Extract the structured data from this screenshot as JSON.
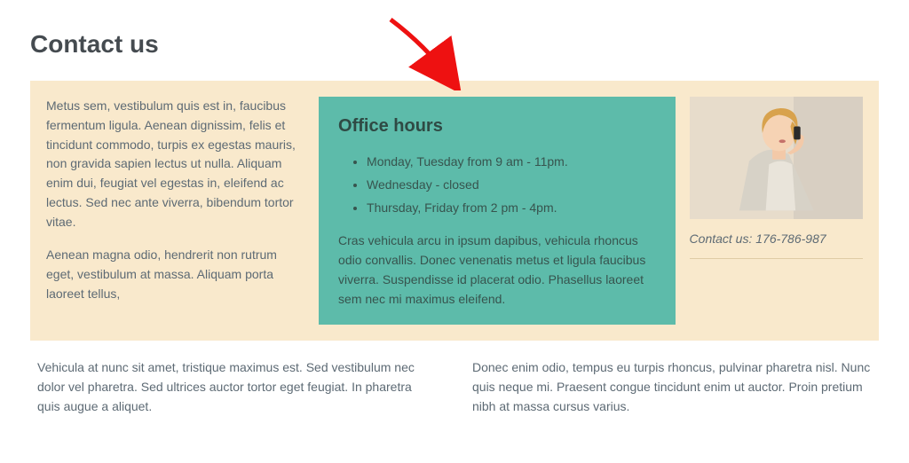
{
  "title": "Contact us",
  "left": {
    "p1": "Metus sem, vestibulum quis est in, faucibus fermentum ligula. Aenean dignissim, felis et tincidunt commodo, turpis ex egestas mauris, non gravida sapien lectus ut nulla. Aliquam enim dui, feugiat vel egestas in, eleifend ac lectus. Sed nec ante viverra, bibendum tortor vitae.",
    "p2": "Aenean magna odio, hendrerit non rutrum eget, vestibulum at massa. Aliquam porta laoreet tellus,"
  },
  "mid": {
    "heading": "Office hours",
    "items": [
      "Monday, Tuesday from 9 am - 11pm.",
      "Wednesday - closed",
      "Thursday, Friday from 2 pm - 4pm."
    ],
    "p": "Cras vehicula arcu in ipsum dapibus, vehicula rhoncus odio convallis. Donec venenatis metus et ligula faucibus viverra. Suspendisse id placerat odio. Phasellus laoreet sem nec mi maximus eleifend."
  },
  "right": {
    "contact": "Contact us: 176-786-987"
  },
  "bottom": {
    "p1": "Vehicula at nunc sit amet, tristique maximus est. Sed vestibulum nec dolor vel pharetra. Sed ultrices auctor tortor eget feugiat. In pharetra quis augue a aliquet.",
    "p2": "Donec enim odio, tempus eu turpis rhoncus, pulvinar pharetra nisl. Nunc quis neque mi. Praesent congue tincidunt enim ut auctor. Proin pretium nibh at massa cursus varius."
  }
}
